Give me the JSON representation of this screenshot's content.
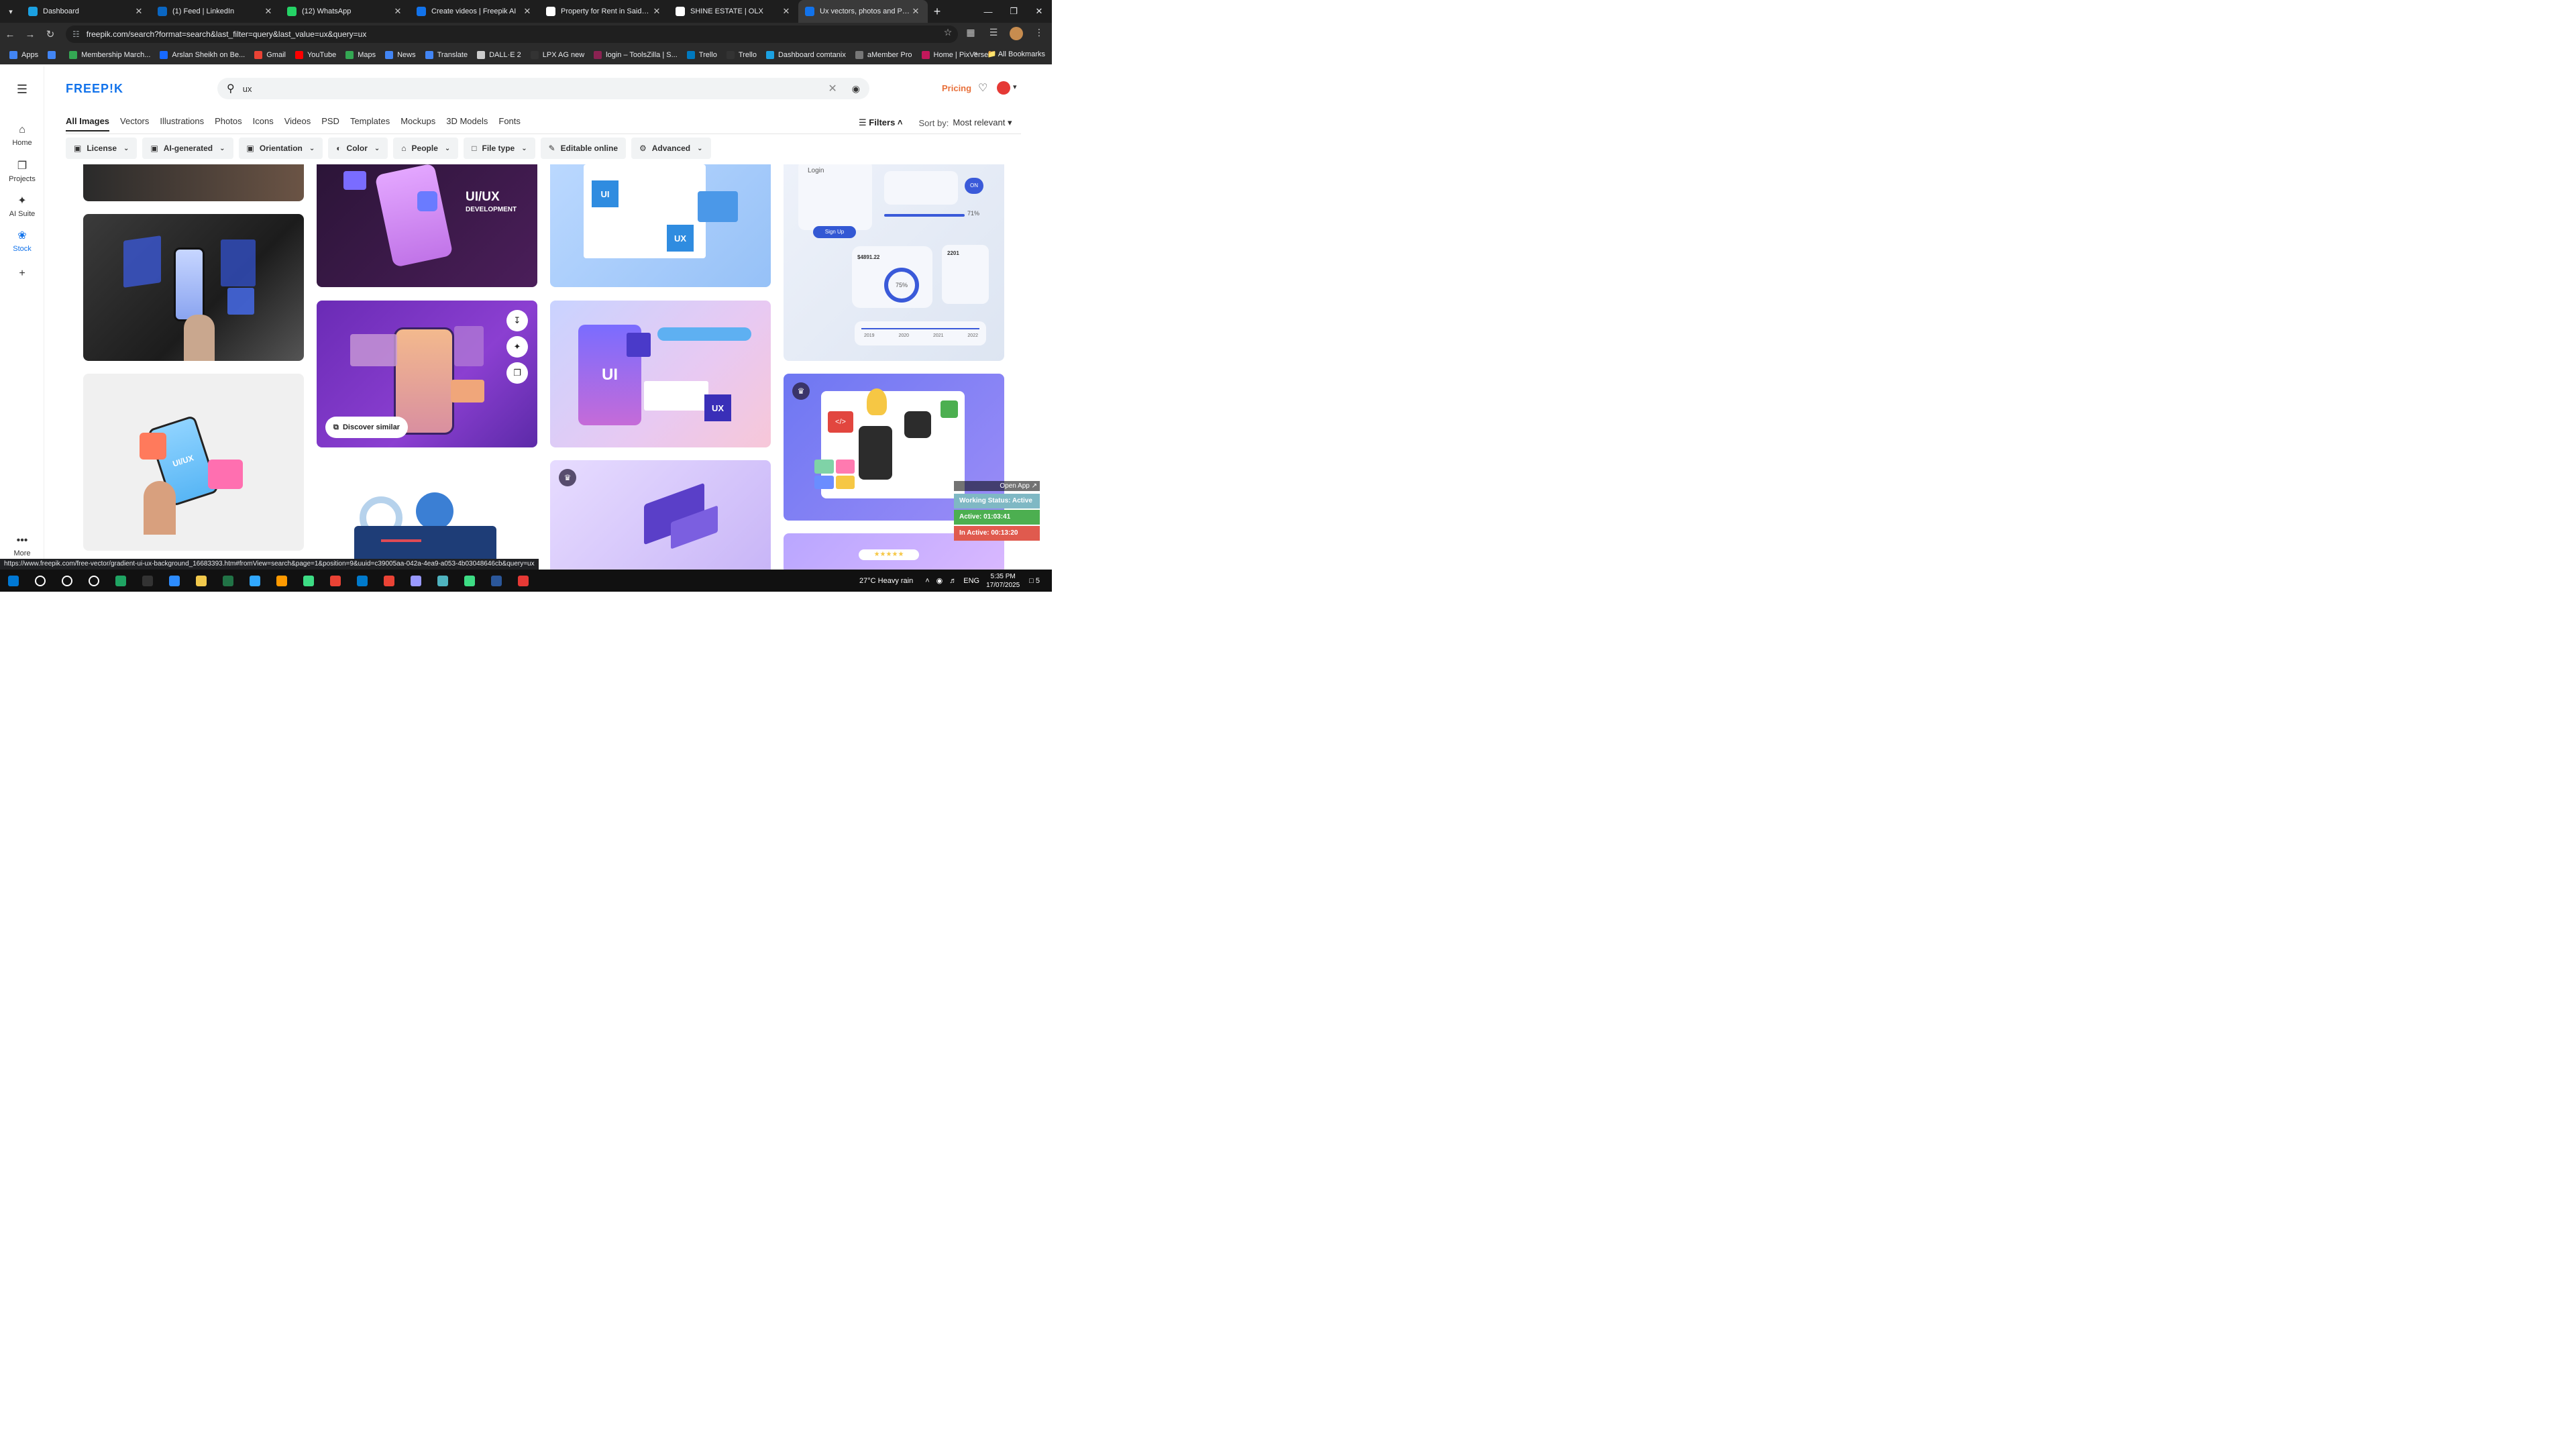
{
  "browser": {
    "tabs": [
      {
        "title": "Dashboard",
        "color": "#1ba1e2",
        "active": false
      },
      {
        "title": "(1) Feed | LinkedIn",
        "color": "#0a66c2",
        "active": false
      },
      {
        "title": "(12) WhatsApp",
        "color": "#25d366",
        "active": false
      },
      {
        "title": "Create videos | Freepik AI",
        "color": "#1273eb",
        "active": false
      },
      {
        "title": "Property for Rent in Saidpur Ro",
        "color": "#ffffff",
        "active": false
      },
      {
        "title": "SHINE ESTATE | OLX",
        "color": "#ffffff",
        "active": false
      },
      {
        "title": "Ux vectors, photos and PSD file",
        "color": "#1273eb",
        "active": true
      }
    ],
    "new_tab": "+",
    "url_site": "☷",
    "url": "freepik.com/search?format=search&last_filter=query&last_value=ux&query=ux",
    "bookmarks": [
      {
        "label": "Apps",
        "color": "#4285f4"
      },
      {
        "label": "",
        "color": "#4285f4"
      },
      {
        "label": "Membership March...",
        "color": "#34a853"
      },
      {
        "label": "Arslan Sheikh on Be...",
        "color": "#1769ff"
      },
      {
        "label": "Gmail",
        "color": "#ea4335"
      },
      {
        "label": "YouTube",
        "color": "#ff0000"
      },
      {
        "label": "Maps",
        "color": "#34a853"
      },
      {
        "label": "News",
        "color": "#4285f4"
      },
      {
        "label": "Translate",
        "color": "#4285f4"
      },
      {
        "label": "DALL·E 2",
        "color": "#cccccc"
      },
      {
        "label": "LPX AG new",
        "color": "#333333"
      },
      {
        "label": "login – ToolsZilla | S...",
        "color": "#8b2252"
      },
      {
        "label": "Trello",
        "color": "#0079bf"
      },
      {
        "label": "Trello",
        "color": "#333333"
      },
      {
        "label": "Dashboard comtanix",
        "color": "#1ba1e2"
      },
      {
        "label": "aMember Pro",
        "color": "#777777"
      },
      {
        "label": "Home | PixVerse",
        "color": "#c2185b"
      }
    ],
    "more_bookmarks": "»",
    "all_bookmarks": "All Bookmarks"
  },
  "freepik": {
    "logo": "FREEP!K",
    "search": {
      "query": "ux"
    },
    "pricing": "Pricing",
    "leftnav": [
      {
        "label": "Home",
        "icon": "⌂"
      },
      {
        "label": "Projects",
        "icon": "❐"
      },
      {
        "label": "AI Suite",
        "icon": "✦"
      },
      {
        "label": "Stock",
        "icon": "❀"
      },
      {
        "label": "",
        "icon": "+"
      },
      {
        "label": "More",
        "icon": "•••"
      }
    ],
    "categories": [
      "All Images",
      "Vectors",
      "Illustrations",
      "Photos",
      "Icons",
      "Videos",
      "PSD",
      "Templates",
      "Mockups",
      "3D Models",
      "Fonts"
    ],
    "filters_label": "Filters",
    "sort_label": "Sort by:",
    "sort_value": "Most relevant",
    "pills": [
      {
        "label": "License",
        "icon": "▣"
      },
      {
        "label": "AI-generated",
        "icon": "▣"
      },
      {
        "label": "Orientation",
        "icon": "▣"
      },
      {
        "label": "Color",
        "icon": "◐"
      },
      {
        "label": "People",
        "icon": "⌂"
      },
      {
        "label": "File type",
        "icon": "□"
      },
      {
        "label": "Editable online",
        "icon": "✎"
      },
      {
        "label": "Advanced",
        "icon": "⚙"
      }
    ],
    "card_text": {
      "uiux_title": "UI/UX",
      "uiux_sub": "DEVELOPMENT",
      "ui": "UI",
      "ux": "UX",
      "uiux_phone": "UI/UX",
      "login": "Login",
      "signup": "Sign Up",
      "price": "$4891.22",
      "percent": "75%",
      "stat": "2201",
      "pct71": "71%",
      "on": "ON",
      "years": [
        "2019",
        "2020",
        "2021",
        "2022"
      ]
    },
    "discover_similar": "Discover similar"
  },
  "tracker": {
    "open_app": "Open App ↗",
    "working": "Working Status: Active",
    "active": "Active: 01:03:41",
    "inactive": "In Active: 00:13:20",
    "colors": {
      "working": "#7fb8c4",
      "active": "#4caf50",
      "inactive": "#e05a4e"
    }
  },
  "status_url": "https://www.freepik.com/free-vector/gradient-ui-ux-background_16683393.htm#fromView=search&page=1&position=9&uuid=c39005aa-042a-4ea9-a053-4b03048646cb&query=ux",
  "taskbar": {
    "apps": [
      "#0078d4",
      "#ffffff",
      "#ffffff",
      "#ffffff",
      "#1fa463",
      "#333333",
      "#2d8cff",
      "#f2c94c",
      "#217346",
      "#31a8ff",
      "#ff9a00",
      "#3ddc84",
      "#ea4335",
      "#007acc",
      "#ea4335",
      "#9999ff",
      "#4fb3bf",
      "#3ddc84",
      "#2b579a",
      "#e53935"
    ],
    "weather": "27°C  Heavy rain",
    "lang": "ENG",
    "time": "5:35 PM",
    "date": "17/07/2025",
    "notifications": "5"
  }
}
